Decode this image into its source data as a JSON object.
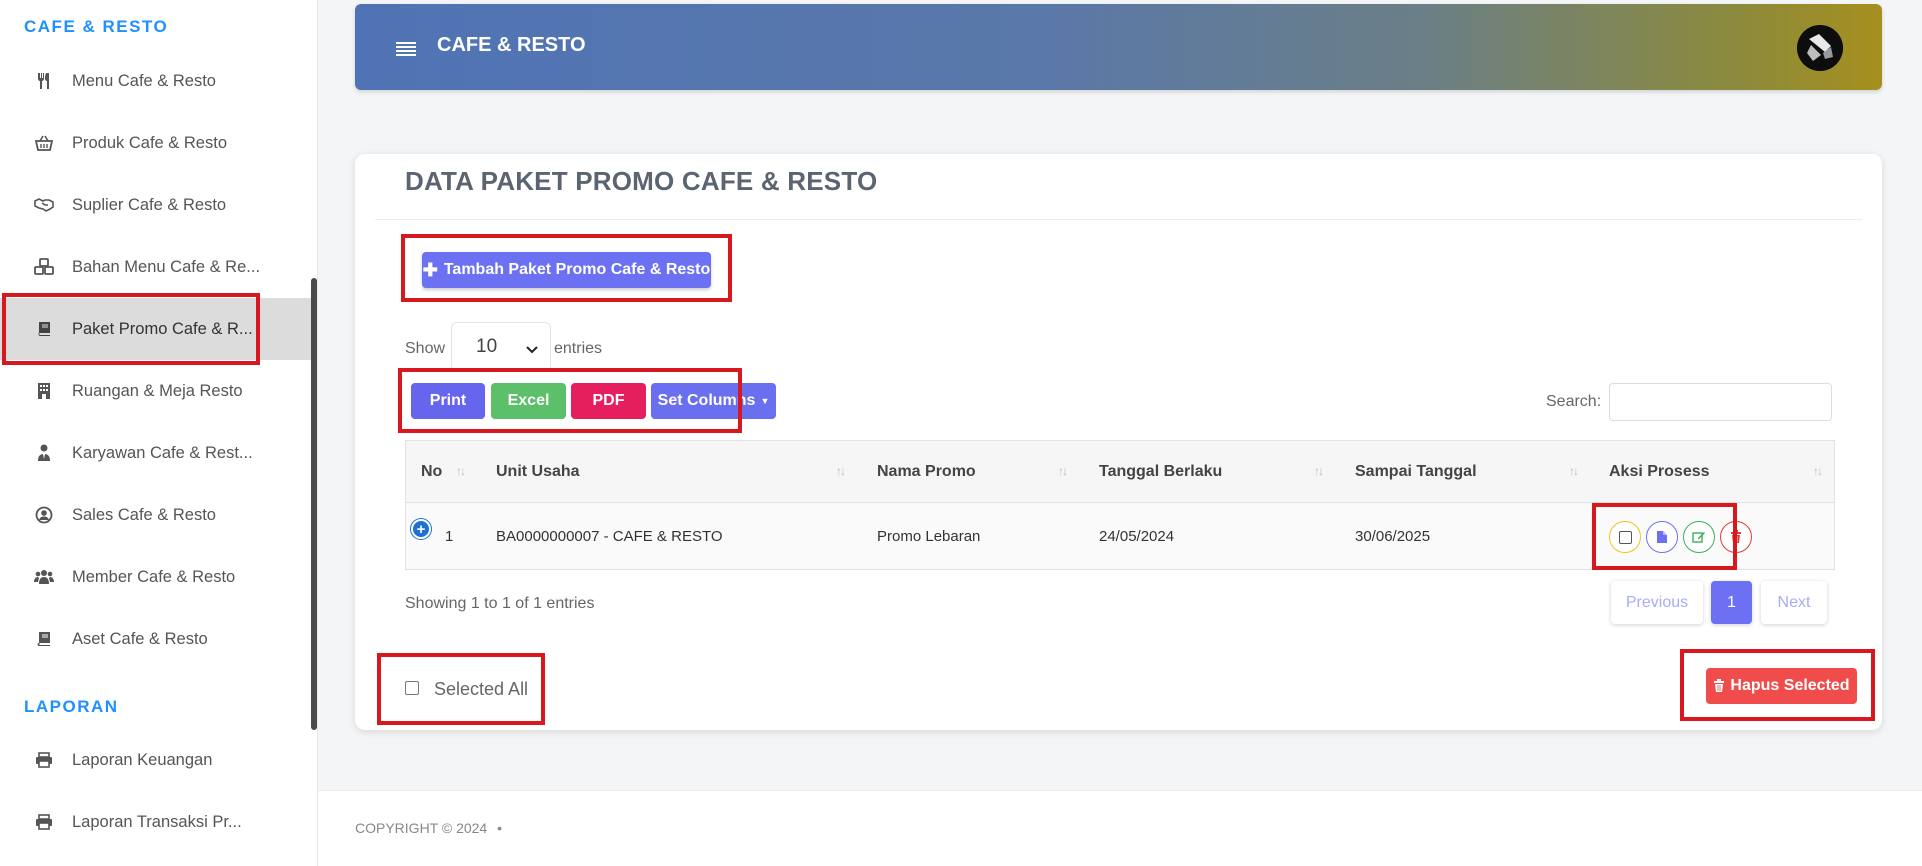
{
  "sidebar": {
    "section_cafe": "CAFE & RESTO",
    "section_laporan": "LAPORAN",
    "items": [
      {
        "label": "Menu Cafe & Resto",
        "icon": "utensils-icon"
      },
      {
        "label": "Produk Cafe & Resto",
        "icon": "basket-icon"
      },
      {
        "label": "Suplier Cafe & Resto",
        "icon": "handshake-icon"
      },
      {
        "label": "Bahan Menu Cafe & Re...",
        "icon": "cubes-icon"
      },
      {
        "label": "Paket Promo Cafe & R...",
        "icon": "book-icon"
      },
      {
        "label": "Ruangan & Meja Resto",
        "icon": "building-icon"
      },
      {
        "label": "Karyawan Cafe & Rest...",
        "icon": "user-tie-icon"
      },
      {
        "label": "Sales Cafe & Resto",
        "icon": "user-circle-icon"
      },
      {
        "label": "Member Cafe & Resto",
        "icon": "users-icon"
      },
      {
        "label": "Aset Cafe & Resto",
        "icon": "book-icon"
      }
    ],
    "laporan_items": [
      {
        "label": "Laporan Keuangan",
        "icon": "printer-icon"
      },
      {
        "label": "Laporan Transaksi Pr...",
        "icon": "printer-icon"
      }
    ]
  },
  "header": {
    "title": "CAFE & RESTO"
  },
  "main": {
    "page_title": "DATA PAKET PROMO CAFE & RESTO",
    "add_button": "Tambah Paket Promo Cafe & Resto",
    "show_label": "Show",
    "entries_value": "10",
    "entries_label": "entries",
    "export_buttons": {
      "print": "Print",
      "excel": "Excel",
      "pdf": "PDF",
      "set_columns": "Set Columns"
    },
    "search_label": "Search:",
    "search_value": "",
    "table": {
      "headers": [
        "No",
        "Unit Usaha",
        "Nama Promo",
        "Tanggal Berlaku",
        "Sampai Tanggal",
        "Aksi Prosess"
      ],
      "rows": [
        {
          "no": "1",
          "unit_usaha": "BA0000000007 - CAFE & RESTO",
          "nama_promo": "Promo Lebaran",
          "tanggal_berlaku": "24/05/2024",
          "sampai_tanggal": "30/06/2025"
        }
      ]
    },
    "info": "Showing 1 to 1 of 1 entries",
    "pagination": {
      "previous": "Previous",
      "current": "1",
      "next": "Next"
    },
    "selected_all": "Selected All",
    "hapus_selected": "Hapus Selected"
  },
  "footer": {
    "copyright": "COPYRIGHT © 2024",
    "separator": "•"
  },
  "colors": {
    "accent": "#6c70f2",
    "section_blue": "#1e90ff",
    "highlight_red": "#d7191f",
    "danger": "#f04c4c",
    "excel_green": "#5cbf6a",
    "pdf_pink": "#e51e5e"
  }
}
